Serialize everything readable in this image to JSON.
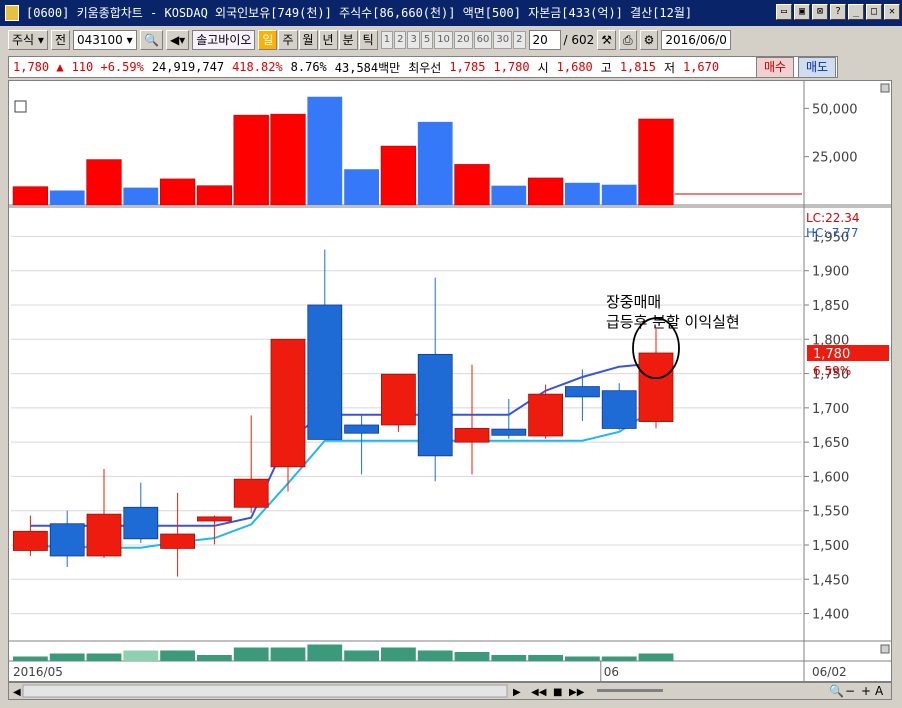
{
  "window": {
    "title": "[0600] 키움종합차트 - KOSDAQ 외국인보유[749(천)] 주식수[86,660(천)] 액면[500] 자본금[433(억)] 결산[12월]"
  },
  "toolbar": {
    "type_label": "주식",
    "all_label": "전",
    "code": "043100",
    "stock_name": "솔고바이오",
    "periods": [
      "일",
      "주",
      "월",
      "년",
      "분",
      "틱"
    ],
    "minute_options": [
      "1",
      "2",
      "3",
      "5",
      "10",
      "20",
      "60",
      "30",
      "2"
    ],
    "count": "20",
    "total": "/ 602",
    "date": "2016/06/0"
  },
  "pricebar": {
    "price": "1,780 ▲",
    "change": "110 +6.59%",
    "volume": "24,919,747",
    "vol_ratio": "418.82%",
    "turnover": "8.76%",
    "amount": "43,584백만",
    "best_label": "최우선",
    "best_ask": "1,785",
    "best_bid": "1,780",
    "open_label": "시",
    "open": "1,680",
    "high_label": "고",
    "high": "1,815",
    "low_label": "저",
    "low": "1,670",
    "buy_label": "매수",
    "sell_label": "매도"
  },
  "chart_data": [
    {
      "type": "bar",
      "name": "volume",
      "ylim": [
        0,
        60000
      ],
      "ticks": [
        "50,000",
        "25,000"
      ],
      "tick_values": [
        50000,
        25000
      ],
      "values": [
        9500,
        7500,
        23500,
        9000,
        13500,
        10000,
        46500,
        47000,
        56000,
        18500,
        30500,
        43000,
        21000,
        10000,
        14000,
        11500,
        10500,
        44500
      ],
      "colors": [
        "red",
        "blue",
        "red",
        "blue",
        "red",
        "red",
        "red",
        "red",
        "blue",
        "blue",
        "red",
        "blue",
        "red",
        "blue",
        "red",
        "blue",
        "blue",
        "red"
      ]
    },
    {
      "type": "candlestick",
      "name": "price",
      "ylim": [
        1360,
        1990
      ],
      "ticks": [
        "1,950",
        "1,900",
        "1,850",
        "1,800",
        "1,750",
        "1,700",
        "1,650",
        "1,600",
        "1,550",
        "1,500",
        "1,450",
        "1,400"
      ],
      "tick_values": [
        1950,
        1900,
        1850,
        1800,
        1750,
        1700,
        1650,
        1600,
        1550,
        1500,
        1450,
        1400
      ],
      "candles": [
        {
          "o": 1492,
          "h": 1543,
          "l": 1484,
          "c": 1520,
          "dir": "up"
        },
        {
          "o": 1531,
          "h": 1550,
          "l": 1468,
          "c": 1484,
          "dir": "down"
        },
        {
          "o": 1484,
          "h": 1611,
          "l": 1481,
          "c": 1545,
          "dir": "up"
        },
        {
          "o": 1555,
          "h": 1591,
          "l": 1503,
          "c": 1509,
          "dir": "down"
        },
        {
          "o": 1495,
          "h": 1576,
          "l": 1454,
          "c": 1516,
          "dir": "up"
        },
        {
          "o": 1535,
          "h": 1543,
          "l": 1501,
          "c": 1541,
          "dir": "up"
        },
        {
          "o": 1555,
          "h": 1689,
          "l": 1547,
          "c": 1596,
          "dir": "up"
        },
        {
          "o": 1614,
          "h": 1800,
          "l": 1578,
          "c": 1800,
          "dir": "up"
        },
        {
          "o": 1850,
          "h": 1931,
          "l": 1657,
          "c": 1654,
          "dir": "down"
        },
        {
          "o": 1675,
          "h": 1690,
          "l": 1603,
          "c": 1663,
          "dir": "down"
        },
        {
          "o": 1675,
          "h": 1745,
          "l": 1665,
          "c": 1749,
          "dir": "up"
        },
        {
          "o": 1778,
          "h": 1890,
          "l": 1593,
          "c": 1630,
          "dir": "down"
        },
        {
          "o": 1650,
          "h": 1763,
          "l": 1603,
          "c": 1670,
          "dir": "up"
        },
        {
          "o": 1669,
          "h": 1713,
          "l": 1655,
          "c": 1660,
          "dir": "down"
        },
        {
          "o": 1659,
          "h": 1734,
          "l": 1655,
          "c": 1720,
          "dir": "up"
        },
        {
          "o": 1731,
          "h": 1756,
          "l": 1681,
          "c": 1716,
          "dir": "down"
        },
        {
          "o": 1725,
          "h": 1736,
          "l": 1668,
          "c": 1670,
          "dir": "down"
        },
        {
          "o": 1680,
          "h": 1815,
          "l": 1670,
          "c": 1780,
          "dir": "up"
        }
      ],
      "line_upper": [
        1528,
        1528,
        1528,
        1528,
        1528,
        1528,
        1540,
        1655,
        1690,
        1690,
        1690,
        1690,
        1690,
        1690,
        1725,
        1745,
        1760,
        1765
      ],
      "line_lower": [
        1498,
        1498,
        1496,
        1496,
        1504,
        1510,
        1530,
        1590,
        1652,
        1652,
        1652,
        1652,
        1652,
        1652,
        1652,
        1652,
        1665,
        1700
      ],
      "lc_label": "LC:22.34",
      "hc_label": "HC:-7.77",
      "last_price": "1,780",
      "last_pct": "6.59%",
      "annotation_line1": "장중매매",
      "annotation_line2": "급등후 분할 이익실현"
    },
    {
      "type": "bar",
      "name": "sub-indicator",
      "values": [
        3,
        5,
        5,
        7,
        7,
        4,
        9,
        9,
        11,
        7,
        9,
        7,
        6,
        4,
        4,
        3,
        3,
        5
      ],
      "ylim": [
        0,
        12
      ]
    }
  ],
  "xaxis": {
    "labels": [
      "2016/05",
      "06",
      "06/02"
    ]
  },
  "colors": {
    "up": "#ee1c0e",
    "down": "#1f6bd6",
    "vol_up": "#ff0000",
    "vol_down": "#3679f8",
    "line_upper": "#3a52e0",
    "line_lower": "#20b8ec",
    "sub": "#3a9a7a"
  },
  "icons": [
    "grid-icon",
    "close-icon",
    "search-icon",
    "speaker-icon",
    "print-icon",
    "settings-icon"
  ]
}
